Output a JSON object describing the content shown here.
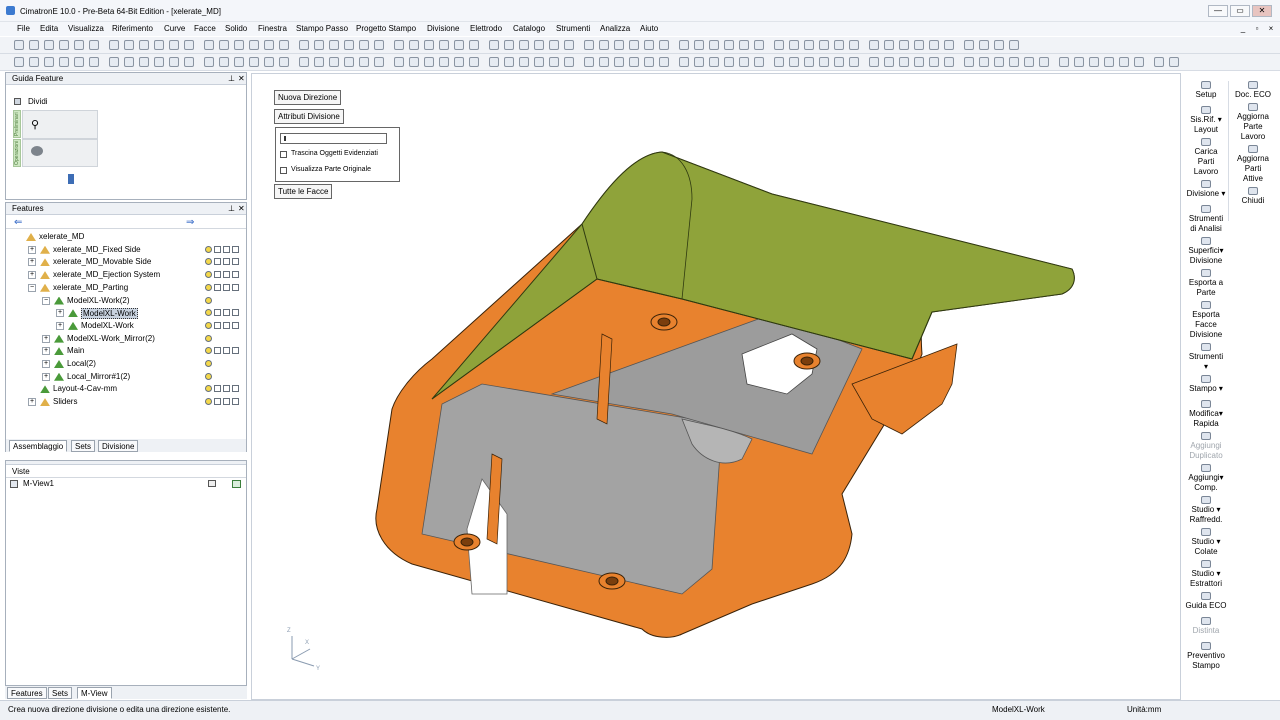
{
  "window": {
    "title": "CimatronE 10.0 - Pre-Beta 64-Bit Edition - [xelerate_MD]",
    "minimize": "—",
    "maximize": "▭",
    "close": "✕"
  },
  "menu": [
    "File",
    "Edita",
    "Visualizza",
    "Riferimento",
    "Curve",
    "Facce",
    "Solido",
    "Finestra",
    "Stampo Passo",
    "Progetto Stampo",
    "Divisione",
    "Elettrodo",
    "Catalogo",
    "Strumenti",
    "Analizza",
    "Aiuto"
  ],
  "mdi_controls": [
    "_",
    "▫",
    "×"
  ],
  "guide_panel": {
    "title": "Guida Feature",
    "item": "Dividi",
    "tab1": "Preliminari",
    "tab2": "Operazioni"
  },
  "features_panel": {
    "title": "Features",
    "rows": [
      {
        "label": "xelerate_MD",
        "level": 0,
        "expander": ""
      },
      {
        "label": "xelerate_MD_Fixed Side",
        "level": 1,
        "expander": "+"
      },
      {
        "label": "xelerate_MD_Movable Side",
        "level": 1,
        "expander": "+"
      },
      {
        "label": "xelerate_MD_Ejection System",
        "level": 1,
        "expander": "+"
      },
      {
        "label": "xelerate_MD_Parting",
        "level": 1,
        "expander": "−"
      },
      {
        "label": "ModelXL-Work(2)",
        "level": 2,
        "expander": "−"
      },
      {
        "label": "ModelXL-Work",
        "level": 3,
        "expander": "+",
        "selected": true
      },
      {
        "label": "ModelXL-Work",
        "level": 3,
        "expander": "+"
      },
      {
        "label": "ModelXL-Work_Mirror(2)",
        "level": 2,
        "expander": "+"
      },
      {
        "label": "Main",
        "level": 2,
        "expander": "+"
      },
      {
        "label": "Local(2)",
        "level": 2,
        "expander": "+"
      },
      {
        "label": "Local_Mirror#1(2)",
        "level": 2,
        "expander": "+"
      },
      {
        "label": "Layout-4-Cav-mm",
        "level": 1,
        "expander": ""
      },
      {
        "label": "Sliders",
        "level": 1,
        "expander": "+"
      }
    ],
    "tabs": [
      "Assemblaggio",
      "Sets",
      "Divisione"
    ]
  },
  "views_panel": {
    "header": "Viste",
    "row": "M-View1"
  },
  "bottom_tabs": [
    "Features",
    "Sets",
    "M-View"
  ],
  "viewport": {
    "btn_new_direction": "Nuova Direzione",
    "btn_division_attrs": "Attributi Divisione",
    "check_drag": "Trascina Oggetti Evidenziati",
    "check_original": "Visualizza Parte Originale",
    "btn_all_faces": "Tutte le Facce",
    "axis_z": "Z",
    "axis_x": "X",
    "axis_y": "Y"
  },
  "right_tools": [
    {
      "label": "Setup",
      "col": 0
    },
    {
      "label": "Sis.Rif. ▾\nLayout",
      "col": 0
    },
    {
      "label": "Carica\nParti\nLavoro",
      "col": 0
    },
    {
      "label": "Divisione ▾",
      "col": 0
    },
    {
      "label": "Strumenti\ndi Analisi",
      "col": 0
    },
    {
      "label": "Superfici▾\nDivisione",
      "col": 0
    },
    {
      "label": "Esporta a\nParte",
      "col": 0
    },
    {
      "label": "Esporta\nFacce\nDivisione",
      "col": 0
    },
    {
      "label": "Strumenti\n▾",
      "col": 0
    },
    {
      "label": "Stampo ▾",
      "col": 0
    },
    {
      "label": "Modifica▾\nRapida",
      "col": 0
    },
    {
      "label": "Aggiungi\nDuplicato",
      "col": 0,
      "disabled": true
    },
    {
      "label": "Aggiungi▾\nComp.",
      "col": 0
    },
    {
      "label": "Studio ▾\nRaffredd.",
      "col": 0
    },
    {
      "label": "Studio ▾\nColate",
      "col": 0
    },
    {
      "label": "Studio ▾\nEstrattori",
      "col": 0
    },
    {
      "label": "Guida ECO",
      "col": 0
    },
    {
      "label": "Distinta",
      "col": 0,
      "disabled": true
    },
    {
      "label": "Preventivo\nStampo",
      "col": 0
    },
    {
      "label": "Doc. ECO",
      "col": 1
    },
    {
      "label": "Aggiorna\nParte\nLavoro",
      "col": 1
    },
    {
      "label": "Aggiorna\nParti\nAttive",
      "col": 1
    },
    {
      "label": "Chiudi",
      "col": 1
    }
  ],
  "status": {
    "message": "Crea nuova direzione divisione o edita una direzione esistente.",
    "active": "ModelXL-Work",
    "units": "Unità:mm"
  },
  "colors": {
    "part_orange": "#e8822e",
    "top_green": "#8fa33a",
    "core_grey": "#a0a0a0"
  }
}
